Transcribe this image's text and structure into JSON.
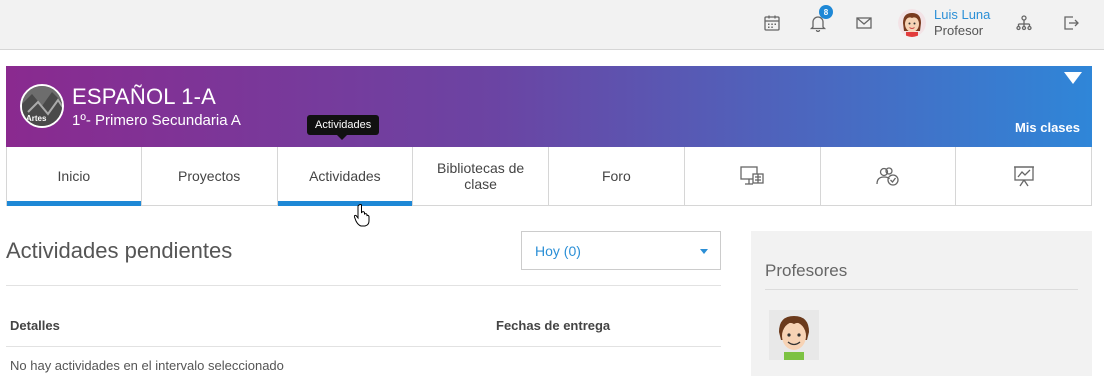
{
  "topbar": {
    "icons": [
      "calendar-icon",
      "bell-icon",
      "mail-icon",
      "org-chart-icon",
      "logout-icon"
    ],
    "notification_count": "8",
    "user": {
      "name": "Luis Luna",
      "role": "Profesor"
    }
  },
  "course": {
    "logo_text": "Artes",
    "title": "ESPAÑOL 1-A",
    "subtitle": "1º- Primero Secundaria A",
    "my_classes": "Mis clases"
  },
  "tabs": [
    {
      "label": "Inicio",
      "state": "active"
    },
    {
      "label": "Proyectos",
      "state": "normal"
    },
    {
      "label": "Actividades",
      "state": "hover"
    },
    {
      "label": "Bibliotecas de clase",
      "state": "normal"
    },
    {
      "label": "Foro",
      "state": "normal"
    },
    {
      "icon": "presentation-icon"
    },
    {
      "icon": "users-check-icon"
    },
    {
      "icon": "chart-board-icon"
    }
  ],
  "tooltip": "Actividades",
  "main": {
    "title": "Actividades pendientes",
    "date_filter": "Hoy (0)",
    "columns": [
      "Detalles",
      "Fechas de entrega"
    ],
    "empty_message": "No hay actividades en el intervalo seleccionado"
  },
  "side": {
    "title": "Profesores"
  },
  "colors": {
    "accent": "#1e88d6",
    "banner_start": "#8a2a8f",
    "banner_end": "#2f86d8"
  }
}
